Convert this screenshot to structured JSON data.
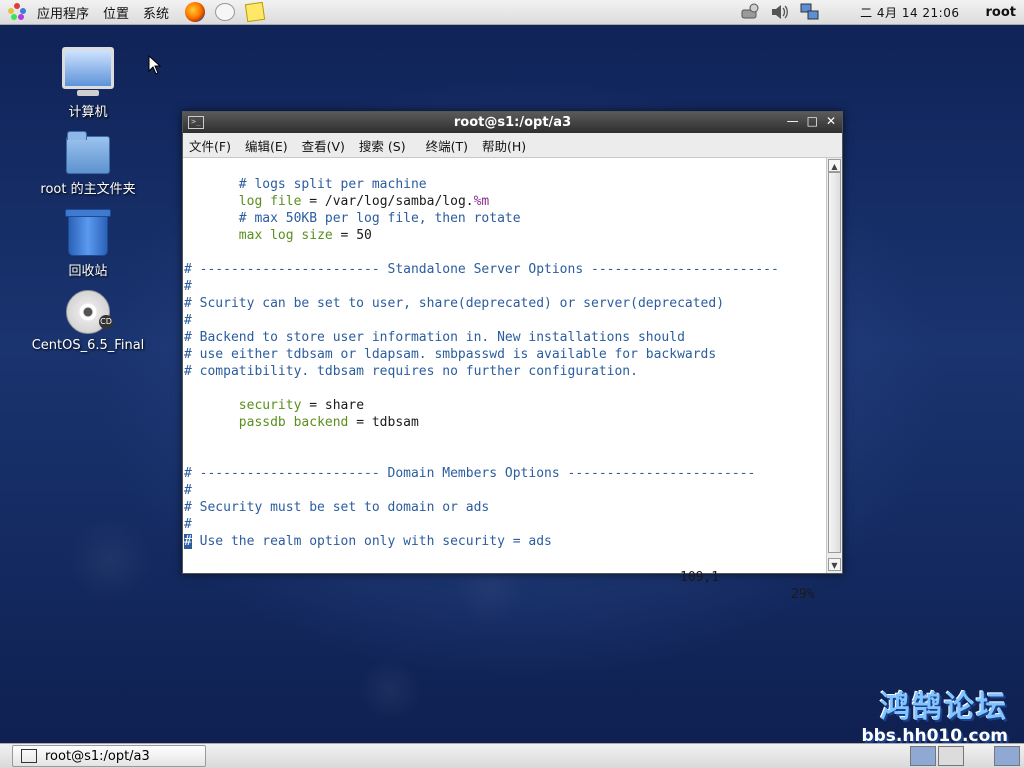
{
  "top_panel": {
    "menus": [
      "应用程序",
      "位置",
      "系统"
    ],
    "clock": "二 4月 14 21:06",
    "user": "root"
  },
  "desktop": {
    "icons": [
      {
        "label": "计算机"
      },
      {
        "label": "root 的主文件夹"
      },
      {
        "label": "回收站"
      },
      {
        "label": "CentOS_6.5_Final",
        "badge": "CD"
      }
    ]
  },
  "terminal": {
    "title": "root@s1:/opt/a3",
    "menu": [
      "文件(F)",
      "编辑(E)",
      "查看(V)",
      "搜索 (S)",
      "终端(T)",
      "帮助(H)"
    ],
    "lines": [
      {
        "segments": [
          {
            "text": "       # logs split per machine",
            "cls": "c-com"
          }
        ]
      },
      {
        "segments": [
          {
            "text": "       ",
            "cls": ""
          },
          {
            "text": "log file",
            "cls": "c-key"
          },
          {
            "text": " = /var/log/samba/log.",
            "cls": ""
          },
          {
            "text": "%m",
            "cls": "c-pur"
          }
        ]
      },
      {
        "segments": [
          {
            "text": "       # max 50KB per log file, then rotate",
            "cls": "c-com"
          }
        ]
      },
      {
        "segments": [
          {
            "text": "       ",
            "cls": ""
          },
          {
            "text": "max log size",
            "cls": "c-key"
          },
          {
            "text": " = 50",
            "cls": ""
          }
        ]
      },
      {
        "segments": []
      },
      {
        "segments": [
          {
            "text": "# ----------------------- Standalone Server Options ------------------------",
            "cls": "c-com"
          }
        ]
      },
      {
        "segments": [
          {
            "text": "#",
            "cls": "c-com"
          }
        ]
      },
      {
        "segments": [
          {
            "text": "# Scurity can be set to user, share(deprecated) or server(deprecated)",
            "cls": "c-com"
          }
        ]
      },
      {
        "segments": [
          {
            "text": "#",
            "cls": "c-com"
          }
        ]
      },
      {
        "segments": [
          {
            "text": "# Backend to store user information in. New installations should",
            "cls": "c-com"
          }
        ]
      },
      {
        "segments": [
          {
            "text": "# use either tdbsam or ldapsam. smbpasswd is available for backwards",
            "cls": "c-com"
          }
        ]
      },
      {
        "segments": [
          {
            "text": "# compatibility. tdbsam requires no further configuration.",
            "cls": "c-com"
          }
        ]
      },
      {
        "segments": []
      },
      {
        "segments": [
          {
            "text": "       ",
            "cls": ""
          },
          {
            "text": "security",
            "cls": "c-key"
          },
          {
            "text": " = share",
            "cls": ""
          }
        ]
      },
      {
        "segments": [
          {
            "text": "       ",
            "cls": ""
          },
          {
            "text": "passdb backend",
            "cls": "c-key"
          },
          {
            "text": " = tdbsam",
            "cls": ""
          }
        ]
      },
      {
        "segments": []
      },
      {
        "segments": []
      },
      {
        "segments": [
          {
            "text": "# ----------------------- Domain Members Options ------------------------",
            "cls": "c-com"
          }
        ]
      },
      {
        "segments": [
          {
            "text": "#",
            "cls": "c-com"
          }
        ]
      },
      {
        "segments": [
          {
            "text": "# Security must be set to domain or ads",
            "cls": "c-com"
          }
        ]
      },
      {
        "segments": [
          {
            "text": "#",
            "cls": "c-com"
          }
        ]
      },
      {
        "segments": [
          {
            "text": "#",
            "cls": "cursor-blk"
          },
          {
            "text": " Use the realm option only with security = ads",
            "cls": "c-com"
          }
        ]
      }
    ],
    "status_pos": "109,1",
    "status_pct": "29%"
  },
  "taskbar": {
    "window_label": "root@s1:/opt/a3"
  },
  "watermark": {
    "title": "鸿鹄论坛",
    "url": "bbs.hh010.com"
  }
}
